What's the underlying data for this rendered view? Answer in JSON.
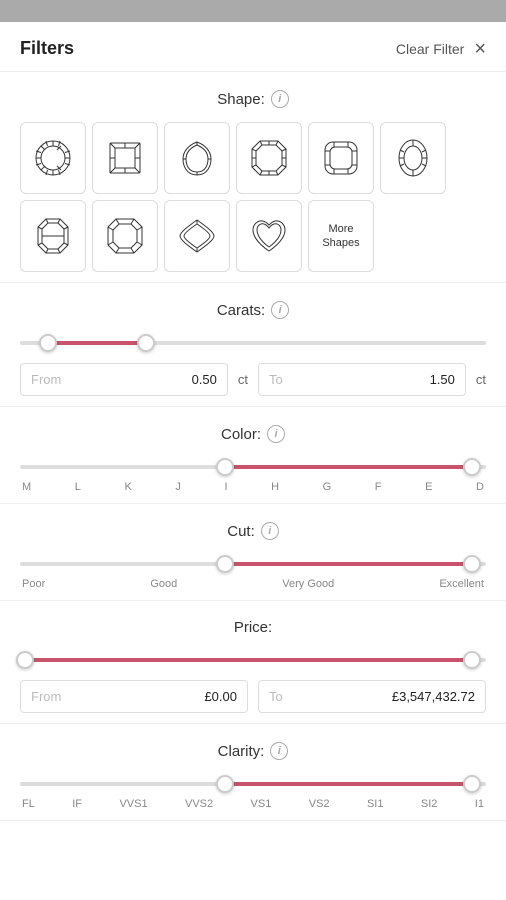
{
  "topbar": {},
  "header": {
    "title": "Filters",
    "clear_filter": "Clear Filter",
    "close_icon": "×"
  },
  "shape_section": {
    "label": "Shape:",
    "info": "i",
    "shapes": [
      {
        "name": "Round",
        "type": "round"
      },
      {
        "name": "Princess",
        "type": "princess"
      },
      {
        "name": "Pear",
        "type": "pear"
      },
      {
        "name": "Radiant",
        "type": "radiant"
      },
      {
        "name": "Cushion",
        "type": "cushion"
      },
      {
        "name": "Oval",
        "type": "oval"
      },
      {
        "name": "Emerald",
        "type": "emerald"
      },
      {
        "name": "Asscher",
        "type": "asscher"
      },
      {
        "name": "Marquise",
        "type": "marquise"
      },
      {
        "name": "Heart",
        "type": "heart"
      }
    ],
    "more_shapes_label": "More Shapes"
  },
  "carats_section": {
    "label": "Carats:",
    "info": "i",
    "from_placeholder": "From",
    "from_value": "0.50",
    "from_unit": "ct",
    "to_placeholder": "To",
    "to_value": "1.50",
    "to_unit": "ct",
    "thumb_left_pct": 6,
    "thumb_right_pct": 27
  },
  "color_section": {
    "label": "Color:",
    "info": "i",
    "labels": [
      "M",
      "L",
      "K",
      "J",
      "I",
      "H",
      "G",
      "F",
      "E",
      "D"
    ],
    "thumb_left_pct": 44,
    "thumb_right_pct": 97,
    "fill_left_pct": 44,
    "fill_right_pct": 97
  },
  "cut_section": {
    "label": "Cut:",
    "info": "i",
    "labels": [
      "Poor",
      "Good",
      "Very Good",
      "Excellent"
    ],
    "thumb_left_pct": 44,
    "thumb_right_pct": 97,
    "fill_left_pct": 44,
    "fill_right_pct": 97
  },
  "price_section": {
    "label": "Price:",
    "from_placeholder": "From",
    "from_value": "£0.00",
    "to_placeholder": "To",
    "to_value": "£3,547,432.72",
    "thumb_left_pct": 1,
    "thumb_right_pct": 97
  },
  "clarity_section": {
    "label": "Clarity:",
    "info": "i",
    "labels": [
      "FL",
      "IF",
      "VVS1",
      "VVS2",
      "VS1",
      "VS2",
      "SI1",
      "SI2",
      "I1"
    ],
    "thumb_left_pct": 44,
    "thumb_right_pct": 97
  }
}
